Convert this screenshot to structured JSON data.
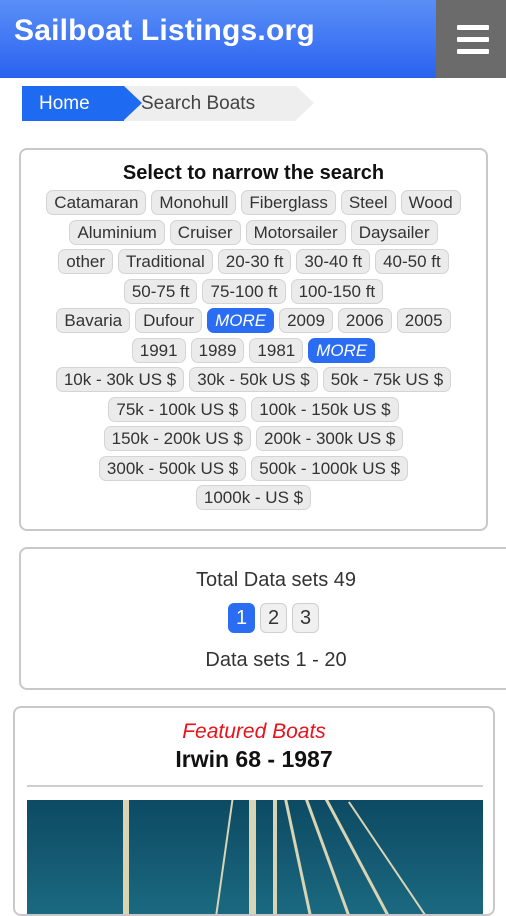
{
  "header": {
    "title": "Sailboat Listings.org",
    "menu_icon": "hamburger-menu-icon"
  },
  "breadcrumb": {
    "home": "Home",
    "current": "Search Boats"
  },
  "filters": {
    "title": "Select to narrow the search",
    "rows": [
      [
        "Catamaran",
        "Monohull",
        "Fiberglass",
        "Steel",
        "Wood"
      ],
      [
        "Aluminium",
        "Cruiser",
        "Motorsailer",
        "Daysailer"
      ],
      [
        "other",
        "Traditional",
        "20-30 ft",
        "30-40 ft",
        "40-50 ft"
      ],
      [
        "50-75 ft",
        "75-100 ft",
        "100-150 ft"
      ],
      [
        "Bavaria",
        "Dufour",
        "MORE",
        "2009",
        "2006",
        "2005"
      ],
      [
        "1991",
        "1989",
        "1981",
        "MORE"
      ],
      [
        "10k - 30k US $",
        "30k - 50k US $",
        "50k - 75k US $"
      ],
      [
        "75k - 100k US $",
        "100k - 150k US $"
      ],
      [
        "150k - 200k US $",
        "200k - 300k US $"
      ],
      [
        "300k - 500k US $",
        "500k - 1000k US $"
      ],
      [
        "1000k - US $"
      ]
    ],
    "more_color": "#2a6cf2"
  },
  "results": {
    "total": "Total Data sets 49",
    "pages": [
      "1",
      "2",
      "3"
    ],
    "active_page": "1",
    "range": "Data sets 1 - 20"
  },
  "featured": {
    "label": "Featured Boats",
    "name": "Irwin 68 - 1987",
    "label_color": "#e8121a"
  },
  "colors": {
    "header": "#2a62f0",
    "accent": "#1e6af0"
  }
}
